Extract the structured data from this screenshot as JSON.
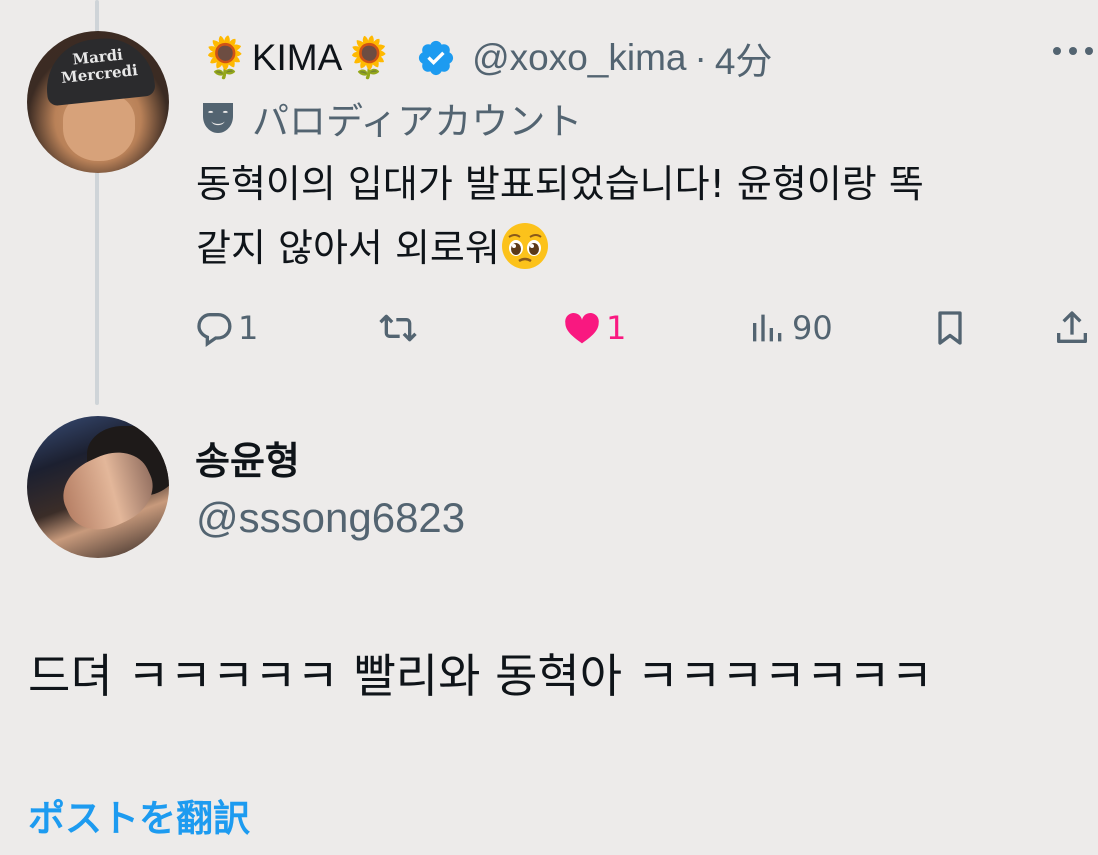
{
  "parent_tweet": {
    "display_name_prefix_emoji": "🌻",
    "display_name": "KIMA",
    "display_name_suffix_emoji": "🌻",
    "handle": "@xoxo_kima",
    "separator": "·",
    "time": "4分",
    "account_label": "パロディアカウント",
    "text_line1": "동혁이의 입대가 발표되었습니다! 윤형이랑 똑",
    "text_line2": "같지 않아서 외로워",
    "avatar_cap_text": "Mardi Mercredi",
    "stats": {
      "replies": "1",
      "reposts": "",
      "likes": "1",
      "views": "90"
    },
    "icons": {
      "verified": "verified-badge-icon",
      "mask": "theater-mask-icon",
      "more": "more-icon",
      "reply": "reply-icon",
      "repost": "repost-icon",
      "like": "heart-icon",
      "views": "views-icon",
      "bookmark": "bookmark-icon",
      "share": "share-icon"
    },
    "colors": {
      "verified": "#1d9bf0",
      "like": "#f91880",
      "secondary_text": "#536471"
    }
  },
  "reply_tweet": {
    "display_name": "송윤형",
    "handle": "@sssong6823",
    "text": "드뎌 ㅋㅋㅋㅋㅋ 빨리와 동혁아 ㅋㅋㅋㅋㅋㅋㅋ",
    "translate_label": "ポストを翻訳"
  }
}
